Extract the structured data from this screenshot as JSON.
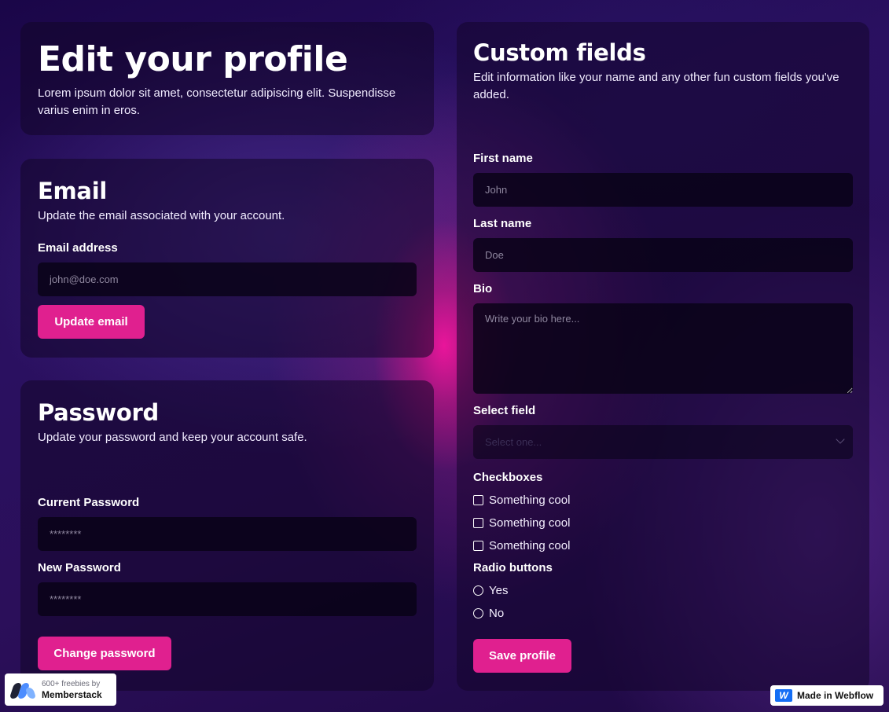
{
  "profile": {
    "title": "Edit your profile",
    "description": "Lorem ipsum dolor sit amet, consectetur adipiscing elit. Suspendisse varius enim in eros."
  },
  "email_section": {
    "title": "Email",
    "description": "Update the email associated with your account.",
    "email_label": "Email address",
    "email_placeholder": "john@doe.com",
    "button": "Update email"
  },
  "password_section": {
    "title": "Password",
    "description": "Update your password and keep your account safe.",
    "current_label": "Current Password",
    "current_placeholder": "********",
    "new_label": "New Password",
    "new_placeholder": "********",
    "button": "Change password"
  },
  "custom_section": {
    "title": "Custom fields",
    "description": "Edit information like your name and any other fun custom fields you've added.",
    "first_name_label": "First name",
    "first_name_placeholder": "John",
    "last_name_label": "Last name",
    "last_name_placeholder": "Doe",
    "bio_label": "Bio",
    "bio_placeholder": "Write your bio here...",
    "select_label": "Select field",
    "select_placeholder": "Select one...",
    "checkboxes_label": "Checkboxes",
    "checkboxes": [
      "Something cool",
      "Something cool",
      "Something cool"
    ],
    "radio_label": "Radio buttons",
    "radios": [
      "Yes",
      "No"
    ],
    "button": "Save profile"
  },
  "badges": {
    "memberstack_small": "600+ freebies by",
    "memberstack_big": "Memberstack",
    "webflow": "Made in Webflow"
  },
  "colors": {
    "accent": "#e0208f",
    "webflow_blue": "#146ef5"
  }
}
